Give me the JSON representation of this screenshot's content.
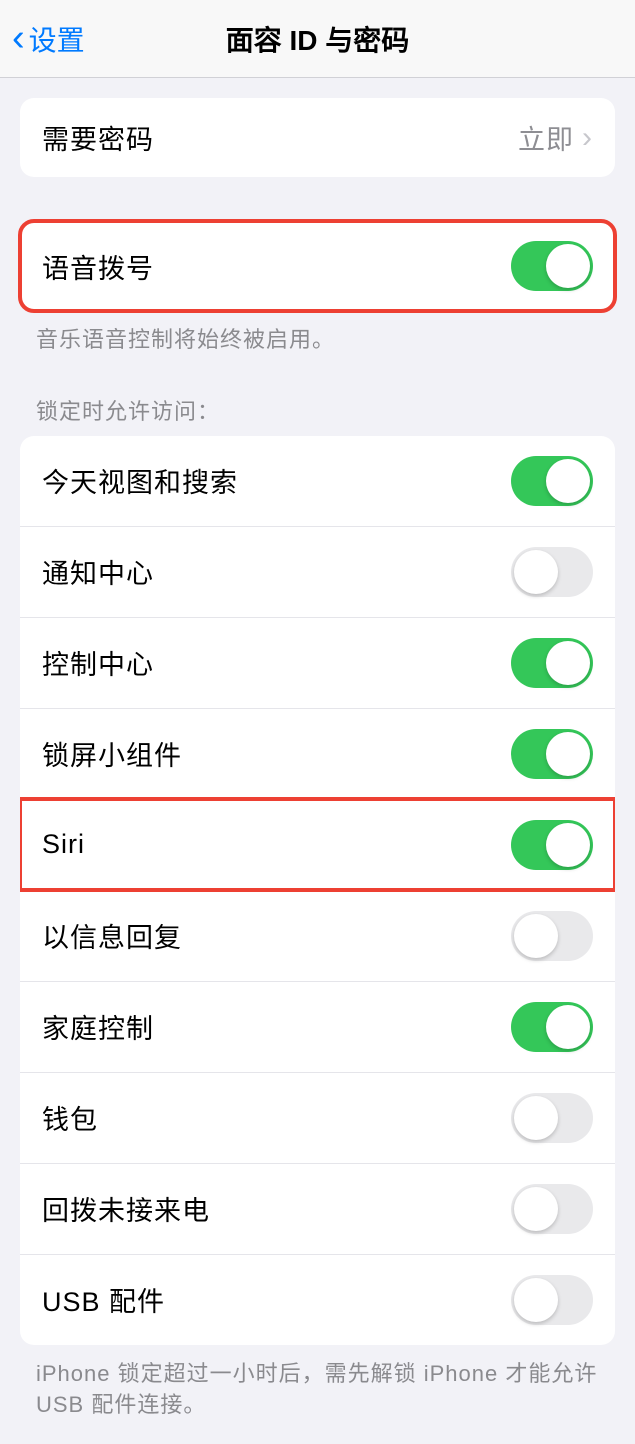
{
  "header": {
    "back_label": "设置",
    "title": "面容 ID 与密码"
  },
  "require_passcode": {
    "label": "需要密码",
    "value": "立即"
  },
  "voice_dial": {
    "label": "语音拨号",
    "enabled": true,
    "footer": "音乐语音控制将始终被启用。"
  },
  "locked_access": {
    "header": "锁定时允许访问：",
    "items": [
      {
        "label": "今天视图和搜索",
        "enabled": true
      },
      {
        "label": "通知中心",
        "enabled": false
      },
      {
        "label": "控制中心",
        "enabled": true
      },
      {
        "label": "锁屏小组件",
        "enabled": true
      },
      {
        "label": "Siri",
        "enabled": true
      },
      {
        "label": "以信息回复",
        "enabled": false
      },
      {
        "label": "家庭控制",
        "enabled": true
      },
      {
        "label": "钱包",
        "enabled": false
      },
      {
        "label": "回拨未接来电",
        "enabled": false
      },
      {
        "label": "USB 配件",
        "enabled": false
      }
    ],
    "footer": "iPhone 锁定超过一小时后，需先解锁 iPhone 才能允许 USB 配件连接。"
  }
}
